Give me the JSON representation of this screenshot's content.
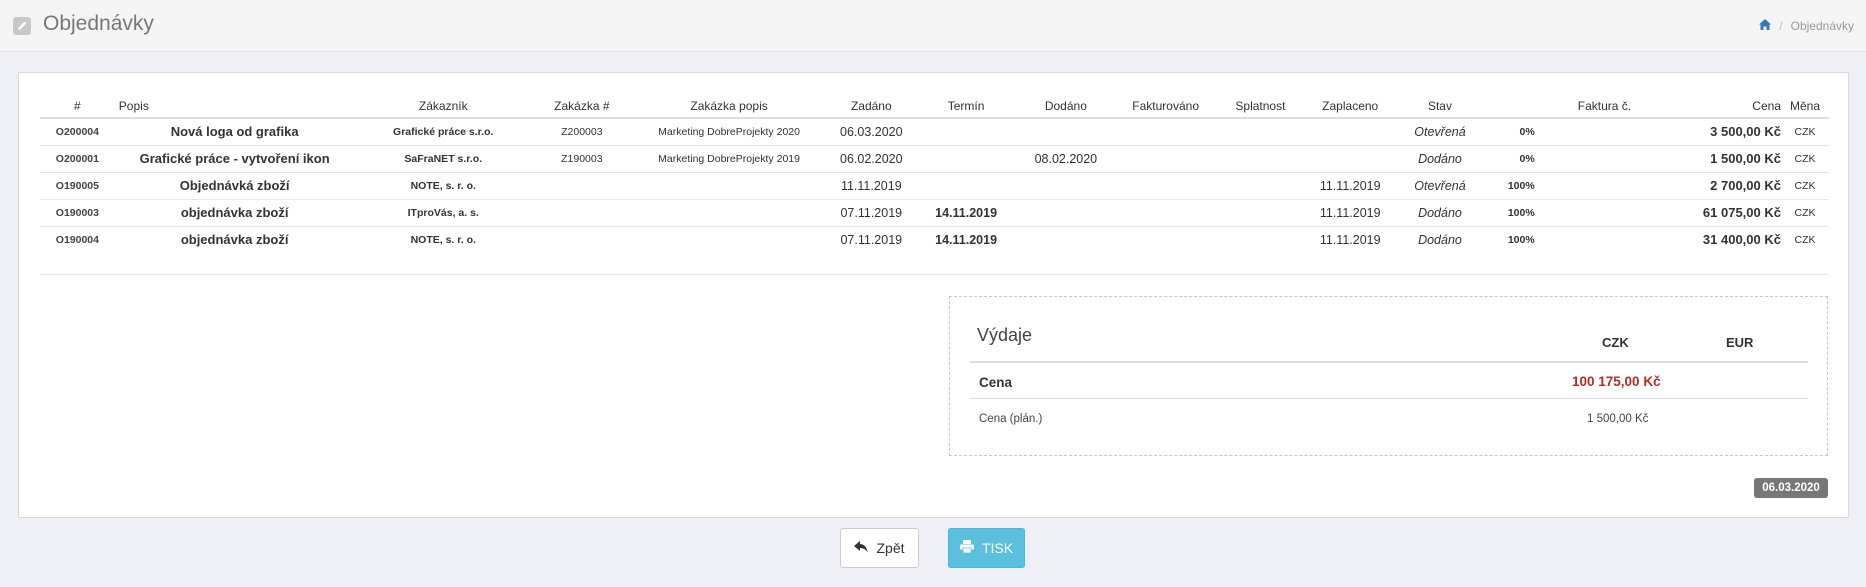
{
  "header": {
    "title": "Objednávky",
    "breadcrumb": {
      "current": "Objednávky",
      "separator": "/"
    }
  },
  "table": {
    "columns": [
      "#",
      "Popis",
      "Zákazník",
      "Zakázka #",
      "Zakázka popis",
      "Zadáno",
      "Termín",
      "Dodáno",
      "Fakturováno",
      "Splatnost",
      "Zaplaceno",
      "Stav",
      "",
      "Faktura č.",
      "Cena",
      "Měna"
    ],
    "rows": [
      {
        "num": "O200004",
        "desc": "Nová loga od grafika",
        "customer": "Grafické práce s.r.o.",
        "project": "Z200003",
        "project_desc": "Marketing DobreProjekty 2020",
        "entered": "06.03.2020",
        "term": "",
        "delivered": "",
        "invoiced": "",
        "due": "",
        "paid": "",
        "status": "Otevřená",
        "percent": "0%",
        "invoice": "",
        "price": "3 500,00 Kč",
        "currency": "CZK"
      },
      {
        "num": "O200001",
        "desc": "Grafické práce - vytvoření ikon",
        "customer": "SaFraNET s.r.o.",
        "project": "Z190003",
        "project_desc": "Marketing DobreProjekty 2019",
        "entered": "06.02.2020",
        "term": "",
        "delivered": "08.02.2020",
        "invoiced": "",
        "due": "",
        "paid": "",
        "status": "Dodáno",
        "percent": "0%",
        "invoice": "",
        "price": "1 500,00 Kč",
        "currency": "CZK"
      },
      {
        "num": "O190005",
        "desc": "Objednávká zboží",
        "customer": "NOTE, s. r. o.",
        "project": "",
        "project_desc": "",
        "entered": "11.11.2019",
        "term": "",
        "delivered": "",
        "invoiced": "",
        "due": "",
        "paid": "11.11.2019",
        "status": "Otevřená",
        "percent": "100%",
        "invoice": "",
        "price": "2 700,00 Kč",
        "currency": "CZK"
      },
      {
        "num": "O190003",
        "desc": "objednávka zboží",
        "customer": "ITproVás, a. s.",
        "project": "",
        "project_desc": "",
        "entered": "07.11.2019",
        "term": "14.11.2019",
        "delivered": "",
        "invoiced": "",
        "due": "",
        "paid": "11.11.2019",
        "status": "Dodáno",
        "percent": "100%",
        "invoice": "",
        "price": "61 075,00 Kč",
        "currency": "CZK"
      },
      {
        "num": "O190004",
        "desc": "objednávka zboží",
        "customer": "NOTE, s. r. o.",
        "project": "",
        "project_desc": "",
        "entered": "07.11.2019",
        "term": "14.11.2019",
        "delivered": "",
        "invoiced": "",
        "due": "",
        "paid": "11.11.2019",
        "status": "Dodáno",
        "percent": "100%",
        "invoice": "",
        "price": "31 400,00 Kč",
        "currency": "CZK"
      }
    ]
  },
  "expenses": {
    "title": "Výdaje",
    "col_czk": "CZK",
    "col_eur": "EUR",
    "price_label": "Cena",
    "price_value": "100 175,00 Kč",
    "planned_label": "Cena (plán.)",
    "planned_value": "1 500,00 Kč",
    "price_color": "#b22c2c"
  },
  "date_badge": "06.03.2020",
  "buttons": {
    "back_label": "Zpět",
    "print_label": "TISK",
    "back_icon": "reply-arrow-icon",
    "print_icon": "printer-icon"
  },
  "colors": {
    "print_button": "#5bc0de",
    "breadcrumb_home": "#337ab7"
  }
}
